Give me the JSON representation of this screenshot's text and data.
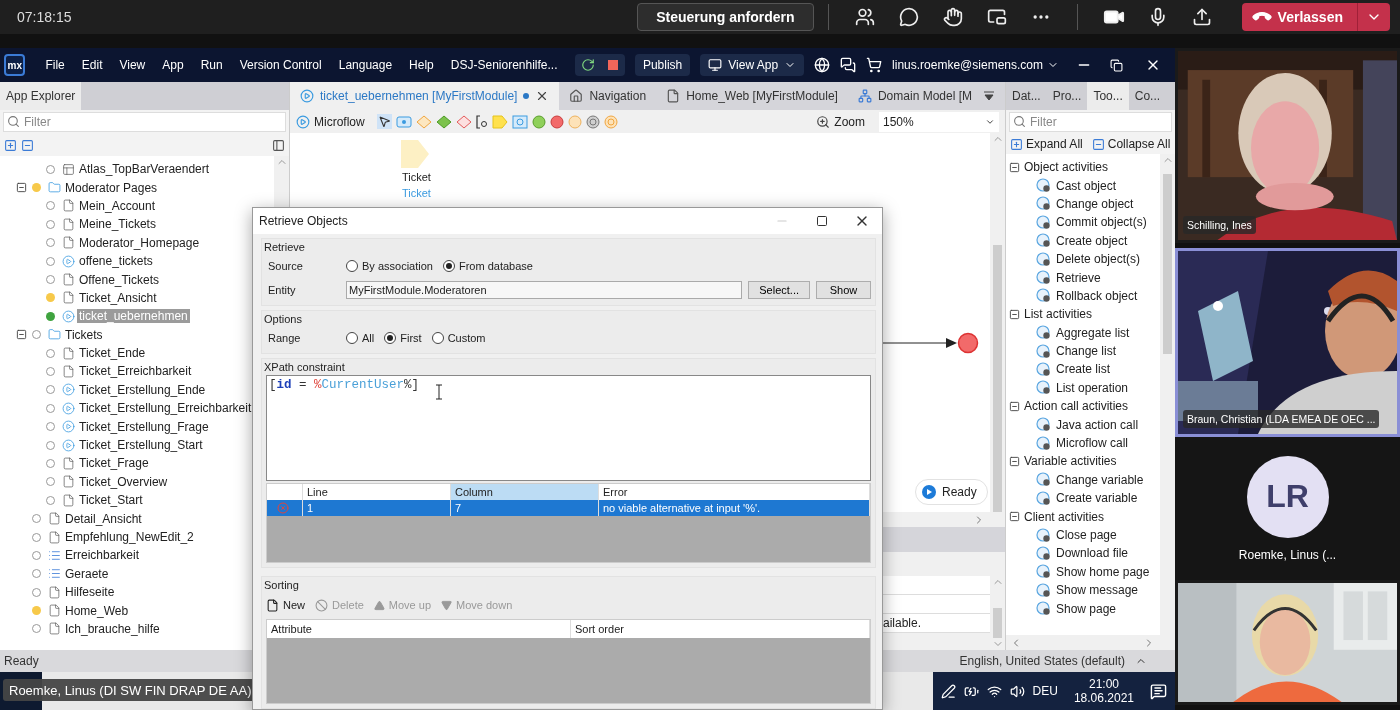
{
  "call_bar": {
    "time": "07:18:15",
    "request_control": "Steuerung anfordern",
    "leave": "Verlassen"
  },
  "menu_bar": {
    "logo": "mx",
    "menus": [
      "File",
      "Edit",
      "View",
      "App",
      "Run",
      "Version Control",
      "Language",
      "Help"
    ],
    "project": "DSJ-Seniorenhilfe...",
    "publish": "Publish",
    "view_app": "View App",
    "account": "linus.roemke@siemens.com"
  },
  "app_explorer": {
    "title": "App Explorer",
    "placeholder": "Filter",
    "tree": [
      {
        "children": [
          {
            "label": "Atlas_TopBarVeraendert",
            "kind": "layout",
            "changed": false,
            "added": false,
            "selected": false
          }
        ]
      },
      {
        "label": "Moderator Pages",
        "kind": "folder",
        "changed": true,
        "added": false,
        "selected": false,
        "expanded": true,
        "children": [
          {
            "label": "Mein_Account",
            "kind": "page",
            "changed": false,
            "added": false,
            "selected": false
          },
          {
            "label": "Meine_Tickets",
            "kind": "page",
            "changed": false,
            "added": false,
            "selected": false
          },
          {
            "label": "Moderator_Homepage",
            "kind": "page",
            "changed": false,
            "added": false,
            "selected": false
          },
          {
            "label": "offene_tickets",
            "kind": "microflow",
            "changed": false,
            "added": false,
            "selected": false
          },
          {
            "label": "Offene_Tickets",
            "kind": "page",
            "changed": false,
            "added": false,
            "selected": false
          },
          {
            "label": "Ticket_Ansicht",
            "kind": "page",
            "changed": true,
            "added": false,
            "selected": false
          },
          {
            "label": "ticket_uebernehmen",
            "kind": "microflow",
            "changed": false,
            "added": true,
            "selected": true
          }
        ]
      },
      {
        "label": "Tickets",
        "kind": "folder",
        "changed": false,
        "added": false,
        "selected": false,
        "expanded": true,
        "children": [
          {
            "label": "Ticket_Ende",
            "kind": "page",
            "changed": false,
            "added": false,
            "selected": false
          },
          {
            "label": "Ticket_Erreichbarkeit",
            "kind": "page",
            "changed": false,
            "added": false,
            "selected": false
          },
          {
            "label": "Ticket_Erstellung_Ende",
            "kind": "microflow",
            "changed": false,
            "added": false,
            "selected": false
          },
          {
            "label": "Ticket_Erstellung_Erreichbarkeit",
            "kind": "microflow",
            "changed": false,
            "added": false,
            "selected": false
          },
          {
            "label": "Ticket_Erstellung_Frage",
            "kind": "microflow",
            "changed": false,
            "added": false,
            "selected": false
          },
          {
            "label": "Ticket_Erstellung_Start",
            "kind": "microflow",
            "changed": false,
            "added": false,
            "selected": false
          },
          {
            "label": "Ticket_Frage",
            "kind": "page",
            "changed": false,
            "added": false,
            "selected": false
          },
          {
            "label": "Ticket_Overview",
            "kind": "page",
            "changed": false,
            "added": false,
            "selected": false
          },
          {
            "label": "Ticket_Start",
            "kind": "page",
            "changed": false,
            "added": false,
            "selected": false
          }
        ]
      },
      {
        "label": "Detail_Ansicht",
        "kind": "page",
        "changed": false,
        "added": false,
        "selected": false
      },
      {
        "label": "Empfehlung_NewEdit_2",
        "kind": "page",
        "changed": false,
        "added": false,
        "selected": false
      },
      {
        "label": "Erreichbarkeit",
        "kind": "list",
        "changed": false,
        "added": false,
        "selected": false
      },
      {
        "label": "Geraete",
        "kind": "list",
        "changed": false,
        "added": false,
        "selected": false
      },
      {
        "label": "Hilfeseite",
        "kind": "page",
        "changed": false,
        "added": false,
        "selected": false
      },
      {
        "label": "Home_Web",
        "kind": "page",
        "changed": true,
        "added": false,
        "selected": false
      },
      {
        "label": "Ich_brauche_hilfe",
        "kind": "page",
        "changed": false,
        "added": false,
        "selected": false
      }
    ]
  },
  "editor": {
    "tabs": [
      {
        "label": "ticket_uebernehmen [MyFirstModule]",
        "kind": "microflow",
        "selected": true,
        "modified": true
      },
      {
        "label": "Navigation",
        "kind": "home",
        "selected": false,
        "modified": false
      },
      {
        "label": "Home_Web [MyFirstModule]",
        "kind": "page",
        "selected": false,
        "modified": false
      },
      {
        "label": "Domain Model [M",
        "kind": "domain",
        "selected": false,
        "modified": false
      }
    ],
    "toolbar": {
      "title": "Microflow",
      "zoom_label": "Zoom",
      "zoom": "150%"
    },
    "canvas": {
      "parameter": {
        "name": "Ticket",
        "type": "Ticket"
      },
      "status": "Ready"
    },
    "lower_pane": {
      "cell": "ailable."
    }
  },
  "toolbox": {
    "tabs": [
      {
        "label": "Dat...",
        "selected": false
      },
      {
        "label": "Pro...",
        "selected": false
      },
      {
        "label": "Too...",
        "selected": true
      },
      {
        "label": "Co...",
        "selected": false
      }
    ],
    "placeholder": "Filter",
    "expand_all": "Expand All",
    "collapse_all": "Collapse All",
    "groups": [
      {
        "label": "Object activities",
        "expanded": true,
        "items": [
          "Cast object",
          "Change object",
          "Commit object(s)",
          "Create object",
          "Delete object(s)",
          "Retrieve",
          "Rollback object"
        ]
      },
      {
        "label": "List activities",
        "expanded": true,
        "items": [
          "Aggregate list",
          "Change list",
          "Create list",
          "List operation"
        ]
      },
      {
        "label": "Action call activities",
        "expanded": true,
        "items": [
          "Java action call",
          "Microflow call"
        ]
      },
      {
        "label": "Variable activities",
        "expanded": true,
        "items": [
          "Change variable",
          "Create variable"
        ]
      },
      {
        "label": "Client activities",
        "expanded": true,
        "items": [
          "Close page",
          "Download file",
          "Show home page",
          "Show message",
          "Show page"
        ]
      }
    ]
  },
  "status_bar": {
    "left": "Ready",
    "language": "English, United States (default)"
  },
  "taskbar": {
    "presenter": "Roemke, Linus (DI SW FIN DRAP DE AA)",
    "lang": "DEU",
    "time": "21:00",
    "date": "18.06.2021"
  },
  "dialog": {
    "title": "Retrieve Objects",
    "retrieve": {
      "title": "Retrieve",
      "source_label": "Source",
      "source_options": [
        {
          "label": "By association",
          "selected": false
        },
        {
          "label": "From database",
          "selected": true
        }
      ],
      "entity_label": "Entity",
      "entity": "MyFirstModule.Moderatoren",
      "select_button": "Select...",
      "show_button": "Show"
    },
    "options": {
      "title": "Options",
      "range_label": "Range",
      "range_options": [
        {
          "label": "All",
          "selected": false
        },
        {
          "label": "First",
          "selected": true
        },
        {
          "label": "Custom",
          "selected": false
        }
      ]
    },
    "xpath": {
      "title": "XPath constraint",
      "tokens": [
        {
          "text": "[",
          "kind": "plain"
        },
        {
          "text": "id",
          "kind": "keyword"
        },
        {
          "text": " = ",
          "kind": "plain"
        },
        {
          "text": "%",
          "kind": "symbol"
        },
        {
          "text": "CurrentUser",
          "kind": "variable"
        },
        {
          "text": "%]",
          "kind": "plain"
        }
      ],
      "error_columns": [
        {
          "label": "Line",
          "selected": false
        },
        {
          "label": "Column",
          "selected": true
        },
        {
          "label": "Error",
          "selected": false
        }
      ],
      "errors": [
        {
          "line": "1",
          "column": "7",
          "error": "no viable alternative at input '%'.",
          "selected": true
        }
      ]
    },
    "sorting": {
      "title": "Sorting",
      "actions": [
        {
          "label": "New",
          "kind": "new",
          "disabled": false
        },
        {
          "label": "Delete",
          "kind": "delete",
          "disabled": true
        },
        {
          "label": "Move up",
          "kind": "up",
          "disabled": true
        },
        {
          "label": "Move down",
          "kind": "down",
          "disabled": true
        }
      ],
      "columns": [
        "Attribute",
        "Sort order"
      ]
    }
  },
  "participants": [
    {
      "kind": "video",
      "name": "Schilling, Ines",
      "speaking": false
    },
    {
      "kind": "video",
      "name": "Braun, Christian (LDA EMEA DE OEC ...",
      "speaking": true
    },
    {
      "kind": "avatar",
      "initials": "LR",
      "name": "Roemke, Linus (...",
      "speaking": false
    },
    {
      "kind": "video",
      "speaking": false
    }
  ]
}
